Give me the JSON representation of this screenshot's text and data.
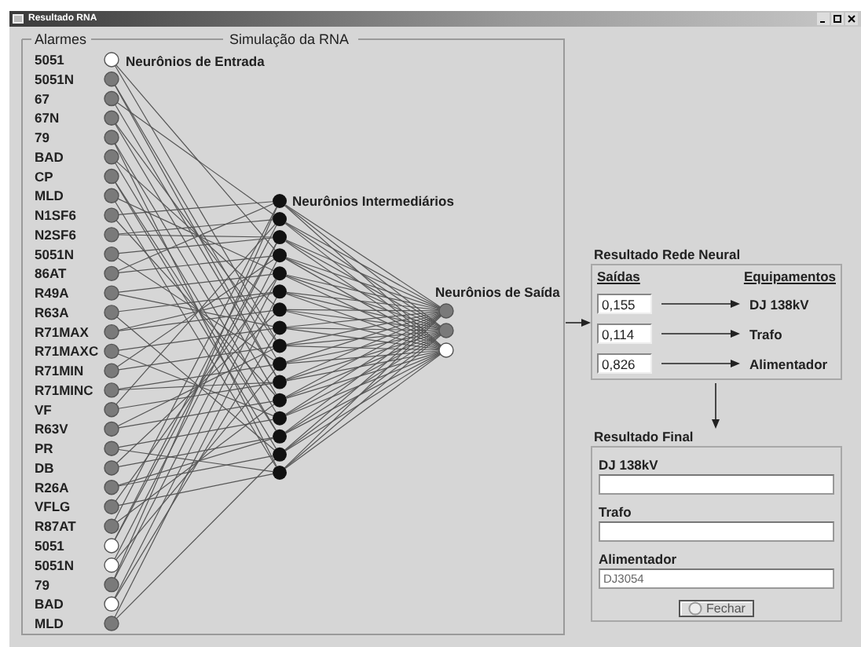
{
  "window": {
    "title": "Resultado RNA"
  },
  "simulation": {
    "alarms_label": "Alarmes",
    "title": "Simulação da RNA",
    "input_label": "Neurônios de Entrada",
    "hidden_label": "Neurônios Intermediários",
    "output_label": "Neurônios de Saída",
    "inputs": [
      {
        "name": "5051",
        "active": true
      },
      {
        "name": "5051N",
        "active": false
      },
      {
        "name": "67",
        "active": false
      },
      {
        "name": "67N",
        "active": false
      },
      {
        "name": "79",
        "active": false
      },
      {
        "name": "BAD",
        "active": false
      },
      {
        "name": "CP",
        "active": false
      },
      {
        "name": "MLD",
        "active": false
      },
      {
        "name": "N1SF6",
        "active": false
      },
      {
        "name": "N2SF6",
        "active": false
      },
      {
        "name": "5051N",
        "active": false
      },
      {
        "name": "86AT",
        "active": false
      },
      {
        "name": "R49A",
        "active": false
      },
      {
        "name": "R63A",
        "active": false
      },
      {
        "name": "R71MAX",
        "active": false
      },
      {
        "name": "R71MAXC",
        "active": false
      },
      {
        "name": "R71MIN",
        "active": false
      },
      {
        "name": "R71MINC",
        "active": false
      },
      {
        "name": "VF",
        "active": false
      },
      {
        "name": "R63V",
        "active": false
      },
      {
        "name": "PR",
        "active": false
      },
      {
        "name": "DB",
        "active": false
      },
      {
        "name": "R26A",
        "active": false
      },
      {
        "name": "VFLG",
        "active": false
      },
      {
        "name": "R87AT",
        "active": false
      },
      {
        "name": "5051",
        "active": true
      },
      {
        "name": "5051N",
        "active": true
      },
      {
        "name": "79",
        "active": false
      },
      {
        "name": "BAD",
        "active": true
      },
      {
        "name": "MLD",
        "active": false
      }
    ],
    "outputs": [
      {
        "active": false
      },
      {
        "active": false
      },
      {
        "active": true
      }
    ]
  },
  "result": {
    "title": "Resultado Rede Neural",
    "outputs_header": "Saídas",
    "equipment_header": "Equipamentos",
    "rows": [
      {
        "value": "0,155",
        "equipment": "DJ 138kV"
      },
      {
        "value": "0,114",
        "equipment": "Trafo"
      },
      {
        "value": "0,826",
        "equipment": "Alimentador"
      }
    ]
  },
  "final": {
    "title": "Resultado Final",
    "fields": [
      {
        "label": "DJ 138kV"
      },
      {
        "label": "Trafo"
      },
      {
        "label": "Alimentador",
        "value": "DJ3054"
      }
    ],
    "close_button": "Fechar"
  }
}
